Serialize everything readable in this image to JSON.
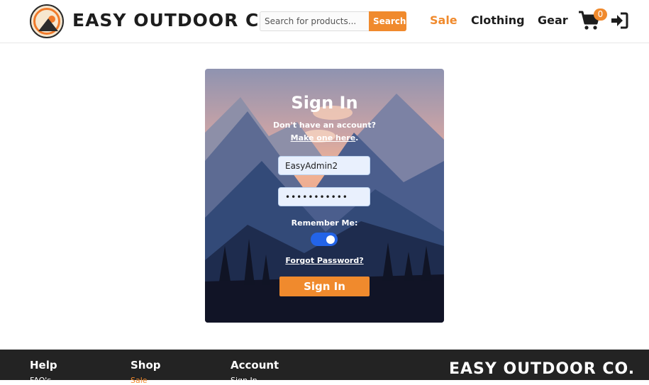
{
  "header": {
    "brand": "EASY OUTDOOR CO.",
    "search": {
      "placeholder": "Search for products...",
      "button": "Search"
    },
    "nav": {
      "sale": "Sale",
      "clothing": "Clothing",
      "gear": "Gear"
    },
    "cart_count": "0"
  },
  "signin": {
    "title": "Sign In",
    "subtitle": "Don't have an account?",
    "make_account_link": "Make one here",
    "make_account_suffix": ".",
    "username_value": "EasyAdmin2",
    "password_value": "•••••••••••",
    "remember_label": "Remember Me:",
    "remember_on": true,
    "forgot_link": "Forgot Password?",
    "submit_label": "Sign In"
  },
  "footer": {
    "help": {
      "title": "Help",
      "item": "FAQ's"
    },
    "shop": {
      "title": "Shop",
      "item": "Sale"
    },
    "account": {
      "title": "Account",
      "item": "Sign In"
    },
    "brand": "EASY OUTDOOR CO."
  },
  "colors": {
    "accent": "#f08a2d",
    "toggle": "#2364e8",
    "footer_bg": "#232323"
  }
}
